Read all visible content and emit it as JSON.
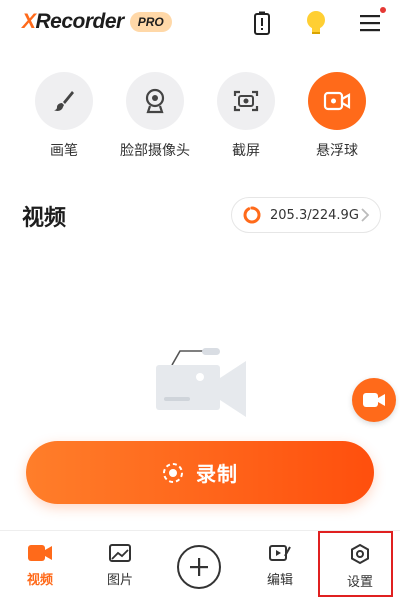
{
  "header": {
    "logo_x": "X",
    "logo_rest": "Recorder",
    "pro_badge": "PRO",
    "icons": [
      "battery-alert-icon",
      "lightbulb-icon",
      "menu-icon"
    ]
  },
  "tools": [
    {
      "label": "画笔",
      "icon": "brush-icon"
    },
    {
      "label": "脸部摄像头",
      "icon": "webcam-icon"
    },
    {
      "label": "截屏",
      "icon": "screenshot-icon"
    },
    {
      "label": "悬浮球",
      "icon": "floating-ball-icon",
      "active": true
    }
  ],
  "section": {
    "title": "视频",
    "storage": "205.3/224.9G",
    "storage_used_fraction": 0.913
  },
  "record": {
    "label": "录制"
  },
  "nav": {
    "items": [
      {
        "label": "视频",
        "icon": "video-icon",
        "active": true
      },
      {
        "label": "图片",
        "icon": "image-icon"
      },
      {
        "label": "",
        "icon": "plus-icon"
      },
      {
        "label": "编辑",
        "icon": "edit-icon"
      },
      {
        "label": "设置",
        "icon": "settings-icon"
      }
    ]
  },
  "colors": {
    "accent": "#ff6a1a",
    "highlight": "#e02020"
  }
}
